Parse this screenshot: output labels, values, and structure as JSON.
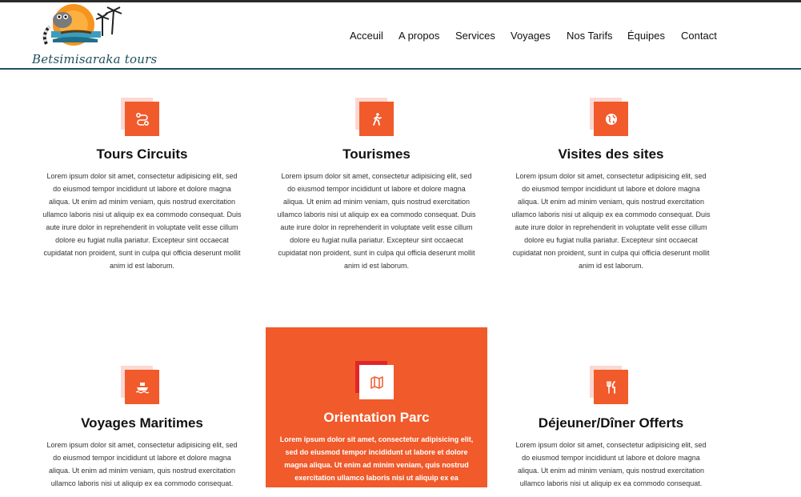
{
  "brand": {
    "logo_text": "Betsimisaraka tours"
  },
  "nav": {
    "items": [
      "Acceuil",
      "A propos",
      "Services",
      "Voyages",
      "Nos Tarifs",
      "Équipes",
      "Contact"
    ]
  },
  "colors": {
    "accent": "#f15a2a",
    "accent_light": "#fbd8d4",
    "nav_border": "#1f4e5f"
  },
  "services": [
    {
      "icon": "route-icon",
      "title": "Tours Circuits",
      "text": "Lorem ipsum dolor sit amet, consectetur adipisicing elit, sed do eiusmod tempor incididunt ut labore et dolore magna aliqua. Ut enim ad minim veniam, quis nostrud exercitation ullamco laboris nisi ut aliquip ex ea commodo consequat. Duis aute irure dolor in reprehenderit in voluptate velit esse cillum dolore eu fugiat nulla pariatur. Excepteur sint occaecat cupidatat non proident, sunt in culpa qui officia deserunt mollit anim id est laborum."
    },
    {
      "icon": "walking-person-icon",
      "title": "Tourismes",
      "text": "Lorem ipsum dolor sit amet, consectetur adipisicing elit, sed do eiusmod tempor incididunt ut labore et dolore magna aliqua. Ut enim ad minim veniam, quis nostrud exercitation ullamco laboris nisi ut aliquip ex ea commodo consequat. Duis aute irure dolor in reprehenderit in voluptate velit esse cillum dolore eu fugiat nulla pariatur. Excepteur sint occaecat cupidatat non proident, sunt in culpa qui officia deserunt mollit anim id est laborum."
    },
    {
      "icon": "globe-icon",
      "title": "Visites des sites",
      "text": "Lorem ipsum dolor sit amet, consectetur adipisicing elit, sed do eiusmod tempor incididunt ut labore et dolore magna aliqua. Ut enim ad minim veniam, quis nostrud exercitation ullamco laboris nisi ut aliquip ex ea commodo consequat. Duis aute irure dolor in reprehenderit in voluptate velit esse cillum dolore eu fugiat nulla pariatur. Excepteur sint occaecat cupidatat non proident, sunt in culpa qui officia deserunt mollit anim id est laborum."
    },
    {
      "icon": "ship-icon",
      "title": "Voyages Maritimes",
      "text": "Lorem ipsum dolor sit amet, consectetur adipisicing elit, sed do eiusmod tempor incididunt ut labore et dolore magna aliqua. Ut enim ad minim veniam, quis nostrud exercitation ullamco laboris nisi ut aliquip ex ea commodo consequat."
    },
    {
      "icon": "map-icon",
      "title": "Orientation Parc",
      "text": "Lorem ipsum dolor sit amet, consectetur adipisicing elit, sed do eiusmod tempor incididunt ut labore et dolore magna aliqua. Ut enim ad minim veniam, quis nostrud exercitation ullamco laboris nisi ut aliquip ex ea commodo consequat."
    },
    {
      "icon": "utensils-icon",
      "title": "Déjeuner/Dîner Offerts",
      "text": "Lorem ipsum dolor sit amet, consectetur adipisicing elit, sed do eiusmod tempor incididunt ut labore et dolore magna aliqua. Ut enim ad minim veniam, quis nostrud exercitation ullamco laboris nisi ut aliquip ex ea commodo consequat."
    }
  ]
}
